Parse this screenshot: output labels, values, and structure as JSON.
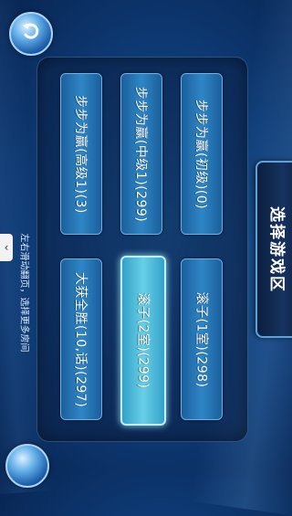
{
  "header": {
    "back_icon": "back-arrow-icon"
  },
  "zone_tab": {
    "label": "选择游戏区"
  },
  "rooms": [
    {
      "label": "步步为赢(初级)(0)"
    },
    {
      "label": "步步为赢(中级1)(299)"
    },
    {
      "label": "步步为赢(高级1)(3)"
    },
    {
      "label": "滚子(1室)(298)"
    },
    {
      "label": "滚子(2室)(299)"
    },
    {
      "label": "大获全胜(10,话)(297)"
    }
  ],
  "hint": {
    "text": "左右滑动翻页，选择更多房间"
  },
  "left_tab": {
    "icon": "chevron-left-icon",
    "glyph": "‹"
  }
}
